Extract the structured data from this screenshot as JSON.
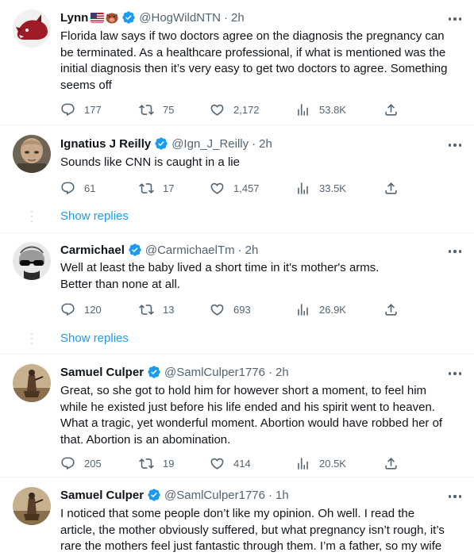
{
  "tweets": [
    {
      "name": "Lynn",
      "flags": [
        "us-flag-emoji",
        "boar-emoji"
      ],
      "verified": true,
      "handle": "@HogWildNTN",
      "time": "2h",
      "text": "Florida law says if two doctors agree on the diagnosis the pregnancy can\nbe terminated. As a healthcare professional, if what is mentioned was the\ninitial diagnosis then it’s very easy to get two doctors to agree. Something\nseems off",
      "replies": "177",
      "retweets": "75",
      "likes": "2,172",
      "views": "53.8K"
    },
    {
      "name": "Ignatius J Reilly",
      "verified": true,
      "handle": "@Ign_J_Reilly",
      "time": "2h",
      "text": "Sounds like CNN is caught in a lie",
      "replies": "61",
      "retweets": "17",
      "likes": "1,457",
      "views": "33.5K",
      "show_replies": "Show replies"
    },
    {
      "name": "Carmichael",
      "verified": true,
      "handle": "@CarmichaelTm",
      "time": "2h",
      "text": "Well at least the baby lived a short time in it's mother's arms.\nBetter than none at all.",
      "replies": "120",
      "retweets": "13",
      "likes": "693",
      "views": "26.9K",
      "show_replies": "Show replies"
    },
    {
      "name": "Samuel Culper",
      "verified": true,
      "handle": "@SamlCulper1776",
      "time": "2h",
      "text": "Great, so she got to hold him for however short a moment, to feel him\nwhile he existed just before his life ended and his spirit went to heaven.\nWhat a tragic, yet wonderful moment. Abortion would have robbed her of\nthat. Abortion is an abomination.",
      "replies": "205",
      "retweets": "19",
      "likes": "414",
      "views": "20.5K"
    },
    {
      "name": "Samuel Culper",
      "verified": true,
      "handle": "@SamlCulper1776",
      "time": "1h",
      "text": "I noticed that some people don’t like my opinion. Oh well. I read the\narticle, the mother obviously suffered, but what pregnancy isn’t rough, it’s\nrare the mothers feel just fantastic through them. I’m a father, so my wife"
    }
  ],
  "colors": {
    "accent": "#1d9bf0",
    "secondary_text": "#536471",
    "primary_text": "#0f1419",
    "divider": "#eff3f4"
  }
}
